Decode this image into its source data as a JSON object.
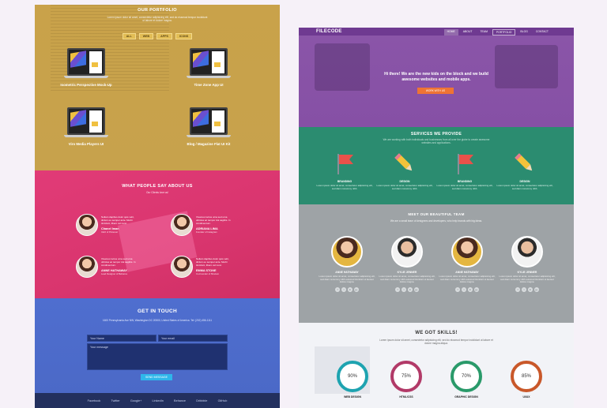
{
  "left": {
    "portfolio": {
      "title": "OUR PORTFOLIO",
      "subtitle": "Lorem ipsum dolor sit amet, consectetur adipisicing elit, sed do eiusmod tempor incididunt ut labore et dolore magna.",
      "filters": [
        "ALL",
        "WEB",
        "APPS",
        "ICONS"
      ],
      "projects": [
        "Isometric Perspective Mock-Up",
        "Time Zone App UI",
        "Viro Media Players UI",
        "Blog / Magazine Flat UI Kit"
      ]
    },
    "testimonials": {
      "title": "WHAT PEOPLE SAY ABOUT US",
      "subtitle": "Our Clients love us!",
      "items": [
        {
          "text": "Nullam dapibus dolor quis velit, dictum eu semper ante. Morbi tincidunt, libero vel nunc.",
          "name": "Chanel Iman",
          "role": "CEO of Pinterest"
        },
        {
          "text": "Vivamus luctus urna sed urna ultricies ac tempor dui sagittis. In condimentum.",
          "name": "ADRIANA LIMA",
          "role": "Founder of Instagram"
        },
        {
          "text": "Vivamus luctus urna sed urna ultricies ac tempor dui sagittis. In condimentum.",
          "name": "ANNE HATHAWAY",
          "role": "Lead Designer of Behance"
        },
        {
          "text": "Nullam dapibus dolor quis velit, dictum eu semper ante. Morbi tincidunt, libero vel nunc.",
          "name": "EMMA STONE",
          "role": "Co-Founder of Shazam"
        }
      ]
    },
    "contact": {
      "title": "GET IN TOUCH",
      "address": "1600 Pennsylvania Ave NW, Washington DC 20500, United States of America. Tel: (202) 456-1111",
      "name_placeholder": "Your Name",
      "email_placeholder": "Your email",
      "message_placeholder": "Your message",
      "send_label": "SEND MESSAGE"
    },
    "footer_links": [
      "Facebook",
      "Twitter",
      "Google+",
      "LinkedIn",
      "Behance",
      "Dribbble",
      "GitHub"
    ]
  },
  "right": {
    "brand": "FILECODE",
    "nav": [
      "HOME",
      "ABOUT",
      "TEAM",
      "PORTFOLIO",
      "BLOG",
      "CONTACT"
    ],
    "hero": {
      "line1": "Hi there! We are the new kids on the block and we build",
      "line2": "awesome websites and mobile apps.",
      "button": "WORK WITH US"
    },
    "services": {
      "title": "SERVICES WE PROVIDE",
      "subtitle": "We are working with both individuals and businesses from all over the globe to create awesome websites and applications.",
      "items": [
        {
          "title": "BRANDING",
          "text": "Lorem ipsum dolor sit amet, consectetur adipisicing elit, sed diam nonummy nibh."
        },
        {
          "title": "DESIGN",
          "text": "Lorem ipsum dolor sit amet, consectetur adipisicing elit, sed diam nonummy nibh."
        },
        {
          "title": "BRANDING",
          "text": "Lorem ipsum dolor sit amet, consectetur adipisicing elit, sed diam nonummy nibh."
        },
        {
          "title": "DESIGN",
          "text": "Lorem ipsum dolor sit amet, consectetur adipisicing elit, sed diam nonummy nibh."
        }
      ]
    },
    "team": {
      "title": "MEET OUR BEAUTIFUL TEAM",
      "subtitle": "We are a small team of designers and developers, who help brands with big ideas.",
      "members": [
        {
          "name": "ANNE HATHAWAY",
          "text": "Lorem ipsum dolor sit amet, consectetur adipisicing elit, sed diam nonummy nibh euismod tincidunt ut laoreet dolore magna."
        },
        {
          "name": "KYLIE JENNER",
          "text": "Lorem ipsum dolor sit amet, consectetur adipisicing elit, sed diam nonummy nibh euismod tincidunt ut laoreet dolore magna."
        },
        {
          "name": "ANNE HATHAWAY",
          "text": "Lorem ipsum dolor sit amet, consectetur adipisicing elit, sed diam nonummy nibh euismod tincidunt ut laoreet dolore magna."
        },
        {
          "name": "KYLIE JENNER",
          "text": "Lorem ipsum dolor sit amet, consectetur adipisicing elit, sed diam nonummy nibh euismod tincidunt ut laoreet dolore magna."
        }
      ],
      "social_icons": [
        "f",
        "t",
        "in",
        "g+"
      ]
    },
    "skills": {
      "title": "WE GOT SKILLS!",
      "subtitle": "Lorem ipsum dolor sit amet, consectetur adipisicing elit, sed do eiusmod tempor incididunt ut labore et dolore magna aliqua.",
      "items": [
        {
          "label": "WEB DESIGN",
          "percent": "90%",
          "color": "#1ea3b0"
        },
        {
          "label": "HTML/CSS",
          "percent": "75%",
          "color": "#b23a68"
        },
        {
          "label": "GRAPHIC DESIGN",
          "percent": "70%",
          "color": "#2a9a6a"
        },
        {
          "label": "UI/UX",
          "percent": "85%",
          "color": "#c9582a"
        }
      ]
    }
  }
}
